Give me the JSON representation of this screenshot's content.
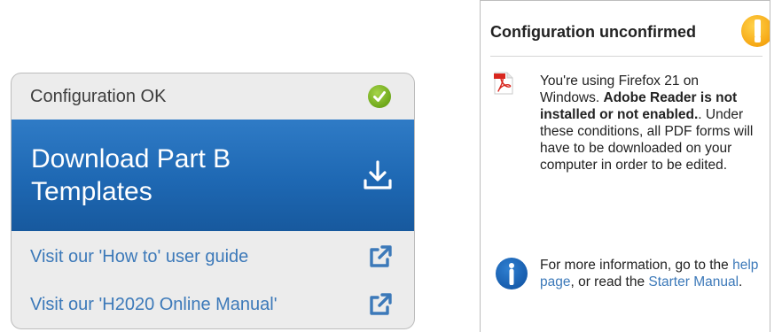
{
  "left_panel": {
    "status_text": "Configuration OK",
    "status_icon": "check-circle-icon",
    "download_label": "Download Part B Templates",
    "download_icon": "download-icon",
    "links": [
      {
        "label": "Visit our 'How to' user guide",
        "icon": "external-link-icon"
      },
      {
        "label": "Visit our 'H2020 Online Manual'",
        "icon": "external-link-icon"
      }
    ],
    "colors": {
      "accent_blue": "#1e68b3",
      "link": "#3c79b9",
      "ok_green": "#6ea81a"
    }
  },
  "right_panel": {
    "title": "Configuration unconfirmed",
    "warning_icon": "warning-icon",
    "pdf_icon": "pdf-file-icon",
    "message_intro": "You're using Firefox 21 on Windows. ",
    "message_bold": "Adobe Reader is not installed or not enabled.",
    "message_rest": ". Under these conditions, all PDF forms will have to be downloaded on your computer in order to be edited.",
    "info_icon": "info-icon",
    "info_prefix": "For more information, go to the ",
    "help_link": "help page",
    "info_middle": ", or read the ",
    "manual_link": "Starter Manual",
    "info_suffix": ".",
    "colors": {
      "warning": "#f6a713",
      "info": "#1458a8"
    }
  }
}
